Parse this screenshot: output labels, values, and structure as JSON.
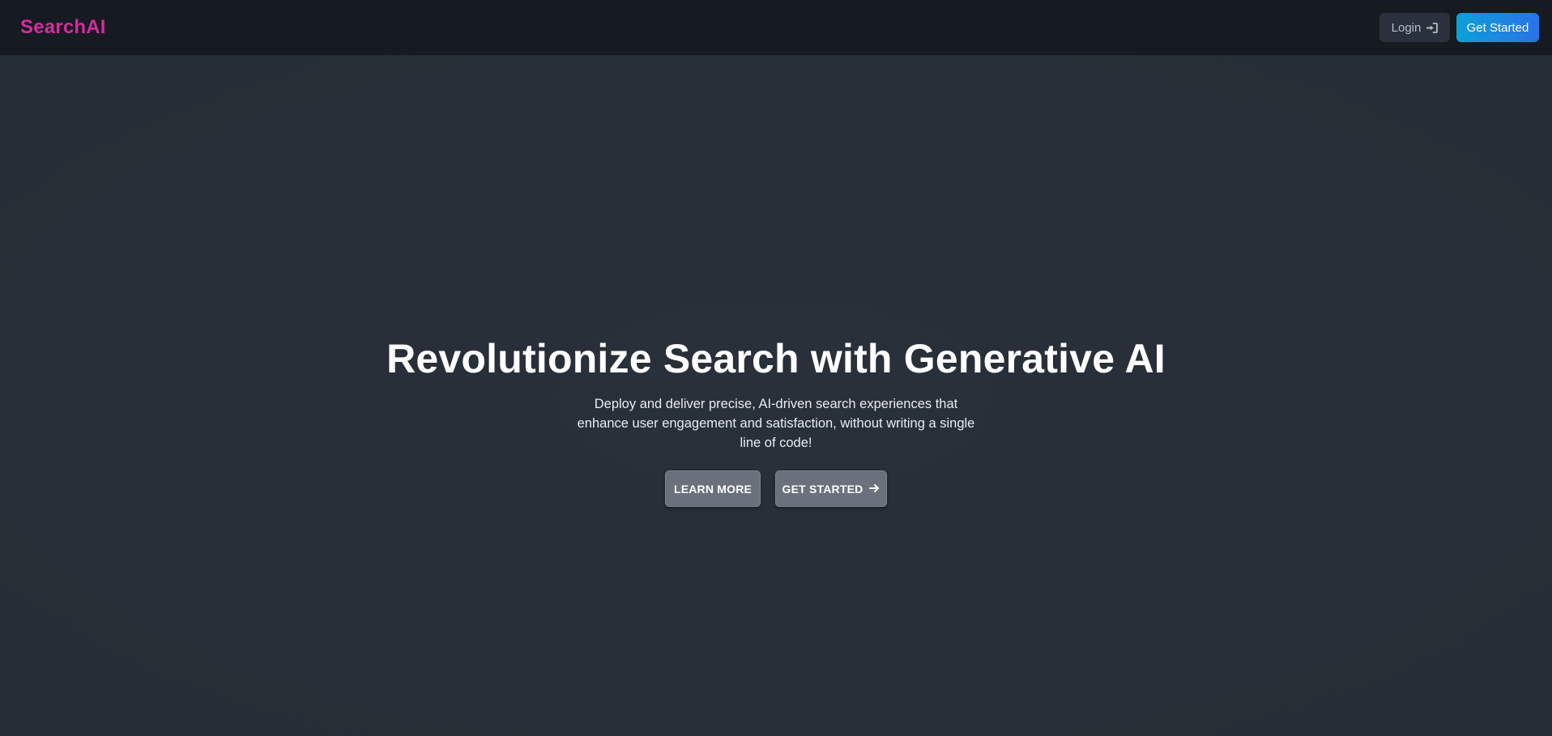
{
  "navbar": {
    "brand": "SearchAI",
    "login_label": "Login",
    "login_icon": "sign-in-icon",
    "get_started_label": "Get Started"
  },
  "hero": {
    "headline": "Revolutionize Search with Generative AI",
    "subtext": "Deploy and deliver precise, AI-driven search experiences that enhance user engagement and satisfaction, without writing a single line of code!",
    "learn_more_label": "LEARN MORE",
    "get_started_label": "GET STARTED",
    "get_started_icon": "arrow-right-icon"
  },
  "colors": {
    "brand": "#d42c9e",
    "page_background": "#272e37",
    "navbar_background": "#161a21",
    "cta_gradient_start": "#0e9fd8",
    "cta_gradient_end": "#2a72e6",
    "hero_button": "#6a717d"
  }
}
